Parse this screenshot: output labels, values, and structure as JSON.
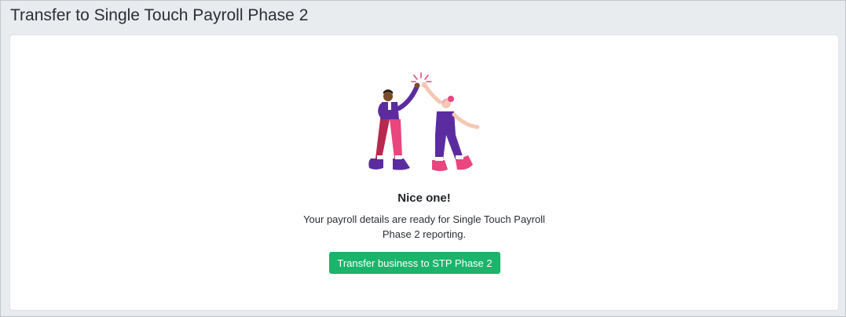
{
  "page": {
    "title": "Transfer to Single Touch Payroll Phase 2"
  },
  "card": {
    "illustration_icon": "high-five-illustration",
    "heading": "Nice one!",
    "message_line1": "Your payroll details are ready for Single Touch Payroll",
    "message_line2": "Phase 2 reporting.",
    "button_label": "Transfer business to STP Phase 2"
  },
  "colors": {
    "page_background": "#e9ecef",
    "card_background": "#ffffff",
    "button_green": "#1cb36b",
    "illustration_purple": "#5b2ca0",
    "illustration_pink": "#e8467c",
    "illustration_crimson": "#b8294f"
  }
}
